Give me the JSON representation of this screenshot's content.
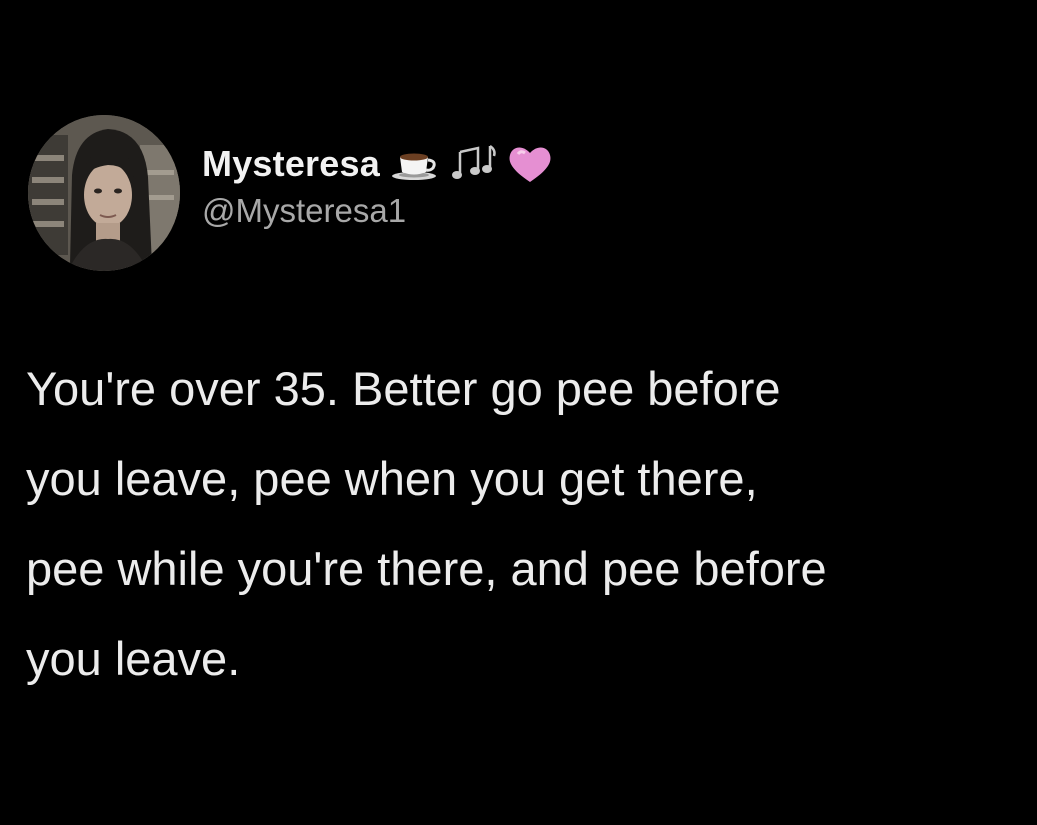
{
  "tweet": {
    "author": {
      "display_name": "Mysteresa",
      "handle": "@Mysteresa1",
      "name_emojis": [
        "coffee-cup-icon",
        "music-notes-icon",
        "pink-heart-icon"
      ]
    },
    "text": "You're over 35. Better go pee before\nyou leave, pee when you get there,\npee while you're there, and pee before\nyou leave."
  },
  "colors": {
    "background": "#000000",
    "name_text": "#f2f2f2",
    "handle_text": "#a8a8a8",
    "body_text": "#ececec",
    "heart": "#e58fd2"
  }
}
